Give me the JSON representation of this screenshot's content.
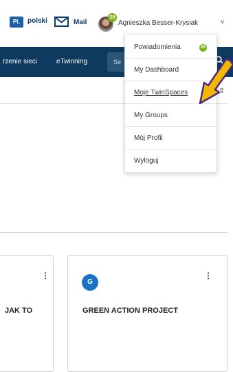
{
  "topbar": {
    "lang_code": "PL",
    "lang_label": "polski",
    "mail_label": "Mail",
    "notifications_count": "29",
    "user_name": "Agnieszka Besser-Krysiak",
    "chevron": "˅"
  },
  "navbar": {
    "items": [
      "rzenie sieci",
      "eTwinning"
    ],
    "search_placeholder": "Se"
  },
  "subnav_right": "g",
  "user_menu": {
    "items": [
      {
        "label": "Powiadomienia",
        "badge": "29"
      },
      {
        "label": "My Dashboard"
      },
      {
        "label": "Moje TwinSpaces"
      },
      {
        "label": "My Groups"
      },
      {
        "label": "Mój Profil"
      },
      {
        "label": "Wyloguj"
      }
    ]
  },
  "cards": [
    {
      "title": "JAK TO",
      "menu": "⋮"
    },
    {
      "title": "GREEN ACTION PROJECT",
      "menu": "⋮",
      "logo_text": "G"
    }
  ],
  "colors": {
    "navbar": "#0e3a5f",
    "badge": "#7cb518",
    "arrow_fill": "#f5b800",
    "arrow_outline": "#4a2a82",
    "logo": "#1a73c7"
  }
}
